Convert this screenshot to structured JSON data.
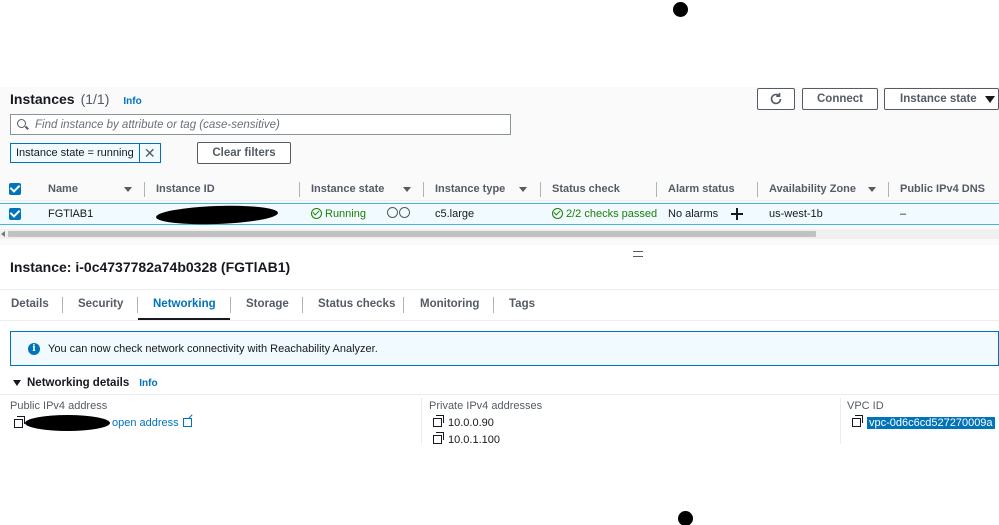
{
  "instances": {
    "title": "Instances",
    "count": "(1/1)",
    "info": "Info",
    "connect_label": "Connect",
    "state_label": "Instance state",
    "search_placeholder": "Find instance by attribute or tag (case-sensitive)",
    "filter_token": "Instance state = running",
    "clear_filters": "Clear filters",
    "columns": [
      "Name",
      "Instance ID",
      "Instance state",
      "Instance type",
      "Status check",
      "Alarm status",
      "Availability Zone",
      "Public IPv4 DNS"
    ],
    "row": {
      "name": "FGTlAB1",
      "state": "Running",
      "type": "c5.large",
      "status_check": "2/2 checks passed",
      "alarm": "No alarms",
      "az": "us-west-1b",
      "dns": "–"
    }
  },
  "detail": {
    "title": "Instance: i-0c4737782a74b0328 (FGTlAB1)",
    "tabs": [
      "Details",
      "Security",
      "Networking",
      "Storage",
      "Status checks",
      "Monitoring",
      "Tags"
    ],
    "active_tab": "Networking",
    "alert": "You can now check network connectivity with Reachability Analyzer.",
    "section_title": "Networking details",
    "section_info": "Info",
    "public_ipv4_label": "Public IPv4 address",
    "open_address": "open address",
    "private_ipv4_label": "Private IPv4 addresses",
    "private_ips": [
      "10.0.0.90",
      "10.0.1.100"
    ],
    "vpc_label": "VPC ID",
    "vpc_id": "vpc-0d6c6cd527270009a"
  },
  "colors": {
    "accent": "#0073bb",
    "success": "#1d8102",
    "text": "#16191f"
  }
}
